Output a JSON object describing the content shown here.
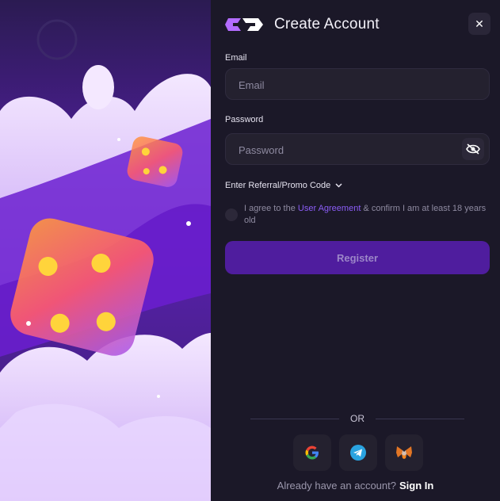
{
  "header": {
    "title": "Create Account",
    "close_icon": "close-icon"
  },
  "form": {
    "email": {
      "label": "Email",
      "placeholder": "Email"
    },
    "password": {
      "label": "Password",
      "placeholder": "Password",
      "toggle_icon": "eye-off-icon"
    },
    "promo": {
      "label": "Enter Referral/Promo Code",
      "icon": "chevron-down-icon"
    },
    "agreement": {
      "text_before": "I agree to the ",
      "link": "User Agreement",
      "text_after": " & confirm I am at least 18 years old"
    },
    "register_label": "Register"
  },
  "divider": {
    "text": "OR"
  },
  "social": [
    {
      "name": "google",
      "icon": "google-icon"
    },
    {
      "name": "telegram",
      "icon": "telegram-icon"
    },
    {
      "name": "metamask",
      "icon": "metamask-icon"
    }
  ],
  "footer": {
    "question": "Already have an account?",
    "signin_label": "Sign In"
  },
  "colors": {
    "panel_bg": "#1b1828",
    "field_bg": "#24212f",
    "accent": "#4f1d9e",
    "link": "#8a5cf5"
  }
}
